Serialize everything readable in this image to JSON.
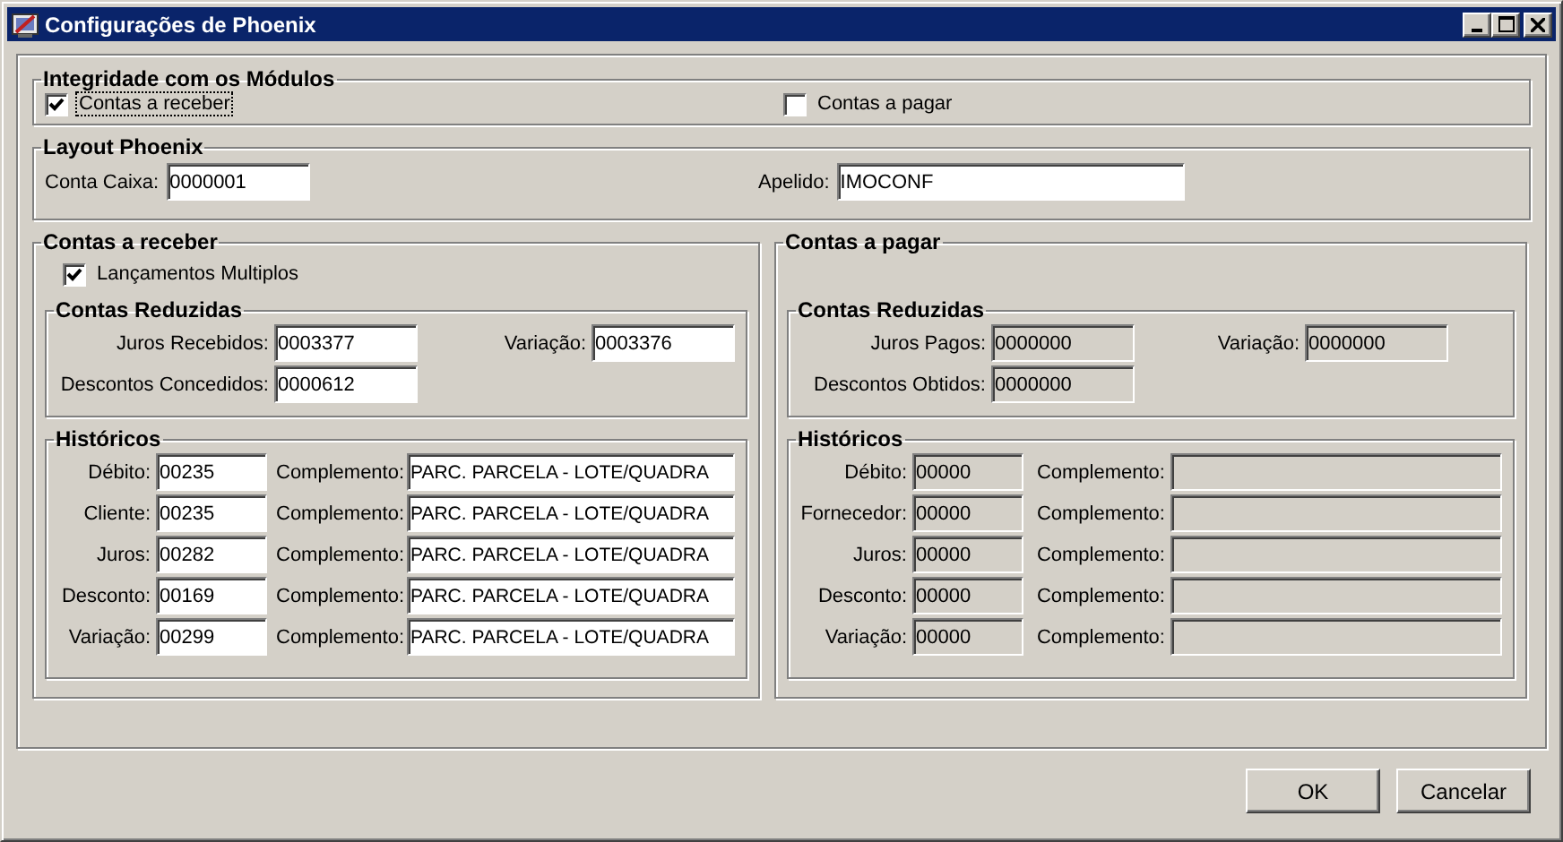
{
  "window": {
    "title": "Configurações de Phoenix"
  },
  "integridade": {
    "title": "Integridade com os Módulos",
    "options": [
      {
        "label": "Contas a receber",
        "checked": true,
        "focused": true
      },
      {
        "label": "Contas a pagar",
        "checked": false,
        "focused": false
      }
    ]
  },
  "layout": {
    "title": "Layout Phoenix",
    "fields": [
      {
        "label": "Conta Caixa:",
        "value": "0000001"
      },
      {
        "label": "Apelido:",
        "value": "IMOCONF"
      }
    ]
  },
  "panels": [
    {
      "title": "Contas a receber",
      "disabled": false,
      "option": {
        "label": "Lançamentos Multiplos",
        "checked": true
      },
      "reduzidas": {
        "title": "Contas  Reduzidas",
        "fields": [
          {
            "label": "Juros Recebidos:",
            "value": "0003377"
          },
          {
            "label": "Variação:",
            "value": "0003376"
          },
          {
            "label": "Descontos Concedidos:",
            "value": "0000612"
          }
        ]
      },
      "historicos": {
        "title": "Históricos",
        "rows": [
          {
            "label": "Débito:",
            "value": "00235",
            "complement_label": "Complemento:",
            "complement": "PARC. PARCELA - LOTE/QUADRA"
          },
          {
            "label": "Cliente:",
            "value": "00235",
            "complement_label": "Complemento:",
            "complement": "PARC. PARCELA - LOTE/QUADRA"
          },
          {
            "label": "Juros:",
            "value": "00282",
            "complement_label": "Complemento:",
            "complement": "PARC. PARCELA - LOTE/QUADRA"
          },
          {
            "label": "Desconto:",
            "value": "00169",
            "complement_label": "Complemento:",
            "complement": "PARC. PARCELA - LOTE/QUADRA"
          },
          {
            "label": "Variação:",
            "value": "00299",
            "complement_label": "Complemento:",
            "complement": "PARC. PARCELA - LOTE/QUADRA"
          }
        ]
      }
    },
    {
      "title": "Contas a pagar",
      "disabled": true,
      "reduzidas": {
        "title": "Contas  Reduzidas",
        "fields": [
          {
            "label": "Juros Pagos:",
            "value": "0000000"
          },
          {
            "label": "Variação:",
            "value": "0000000"
          },
          {
            "label": "Descontos Obtidos:",
            "value": "0000000"
          }
        ]
      },
      "historicos": {
        "title": "Históricos",
        "rows": [
          {
            "label": "Débito:",
            "value": "00000",
            "complement_label": "Complemento:"
          },
          {
            "label": "Fornecedor:",
            "value": "00000",
            "complement_label": "Complemento:"
          },
          {
            "label": "Juros:",
            "value": "00000",
            "complement_label": "Complemento:"
          },
          {
            "label": "Desconto:",
            "value": "00000",
            "complement_label": "Complemento:"
          },
          {
            "label": "Variação:",
            "value": "00000",
            "complement_label": "Complemento:"
          }
        ]
      }
    }
  ],
  "buttons": [
    "OK",
    "Cancelar"
  ]
}
